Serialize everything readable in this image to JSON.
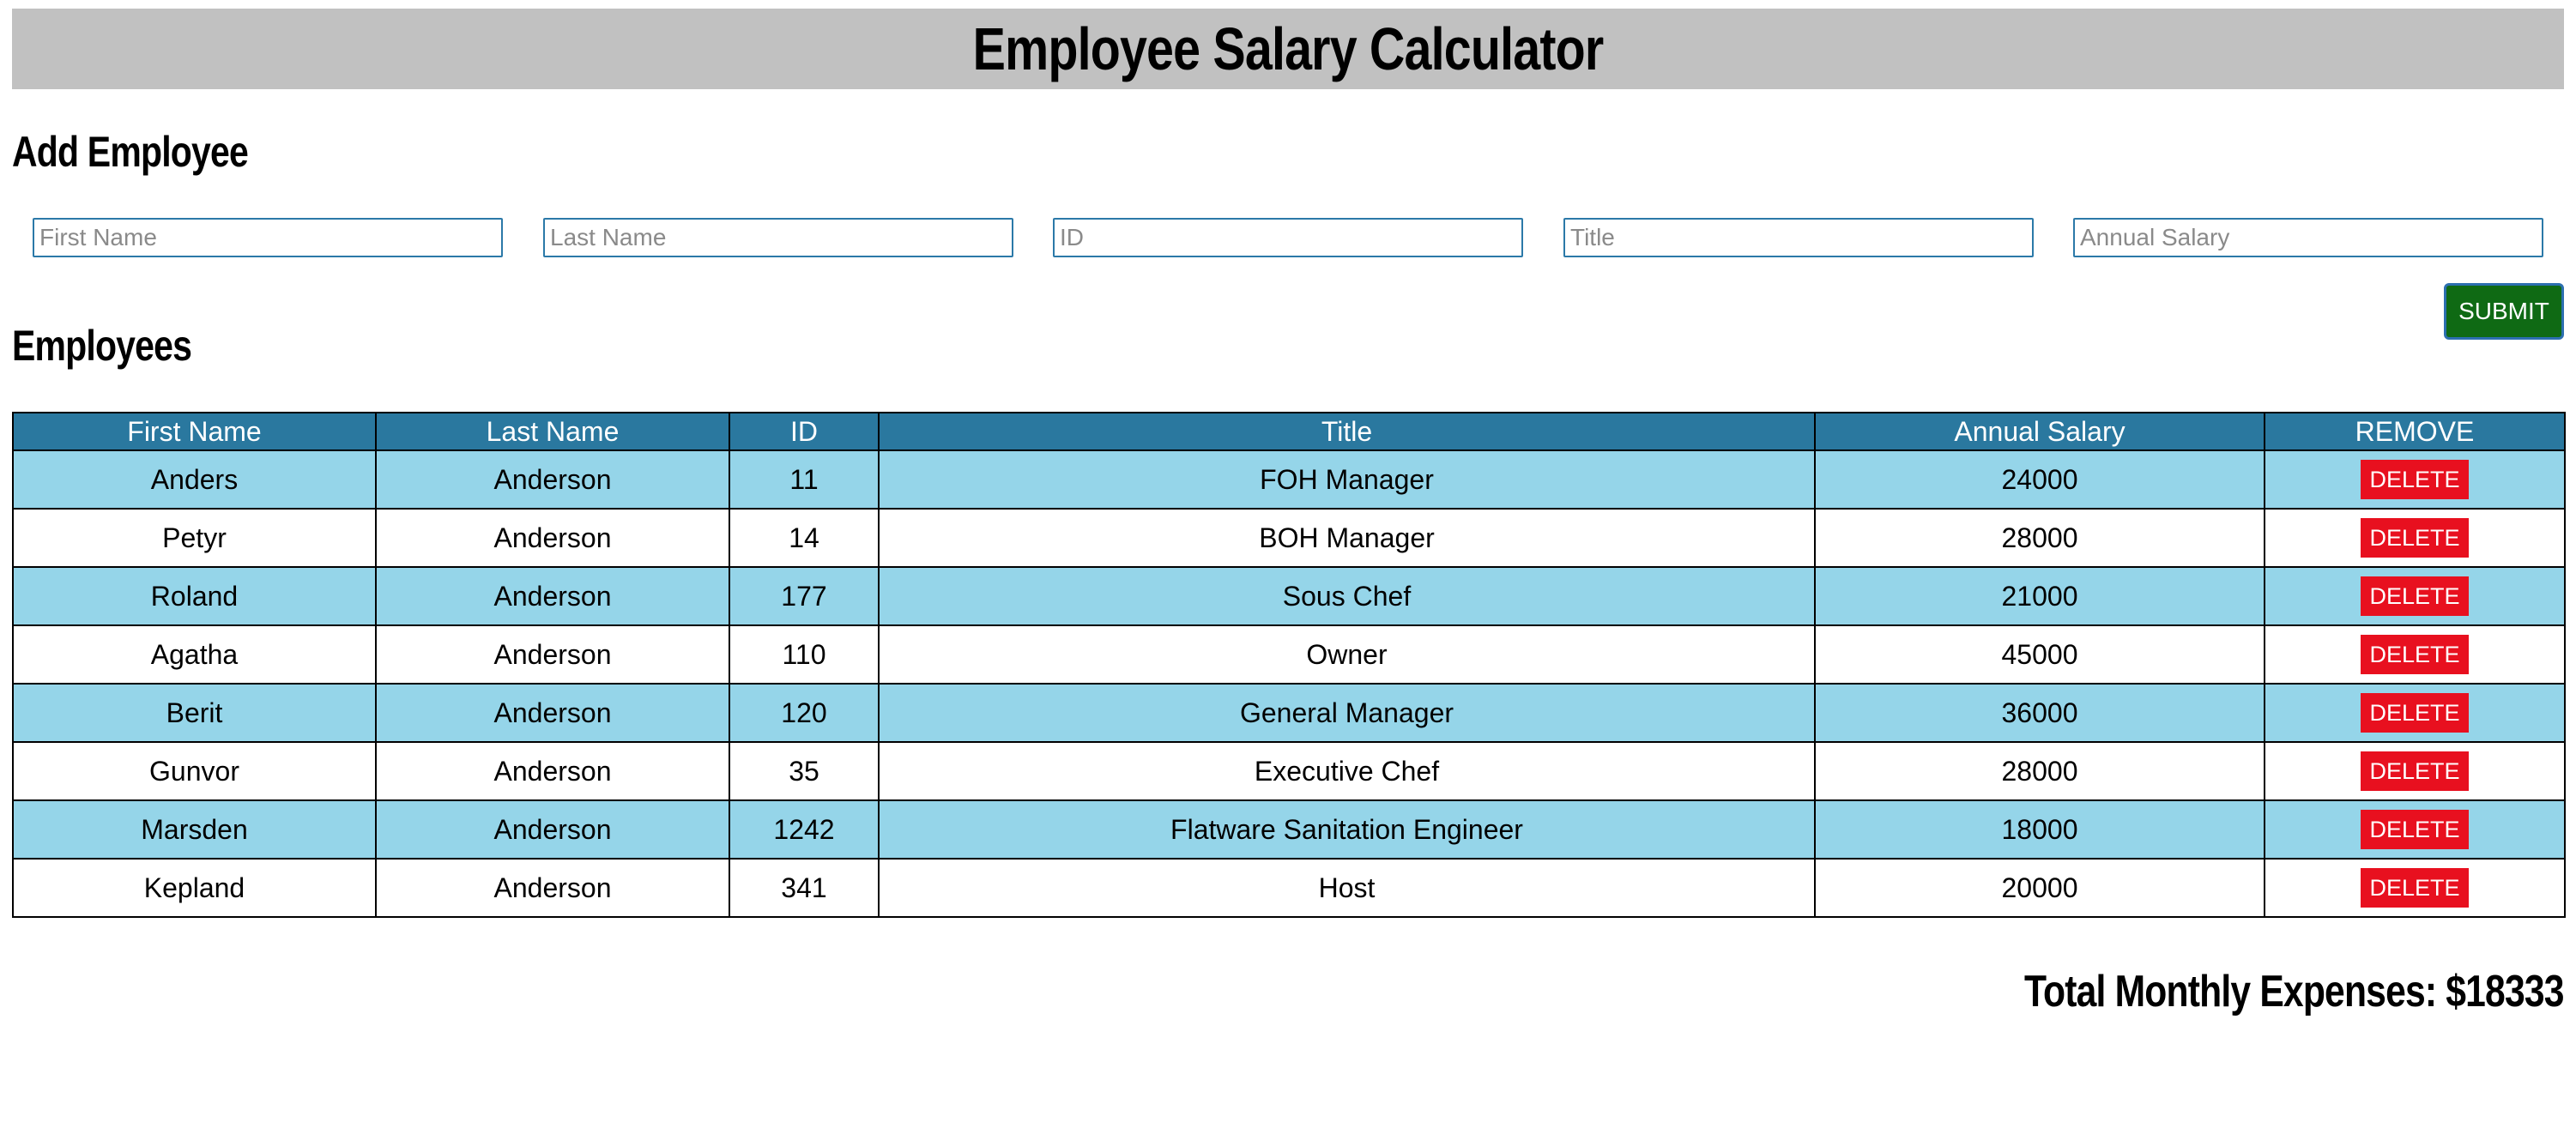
{
  "app": {
    "title": "Employee Salary Calculator"
  },
  "add_section": {
    "title": "Add Employee",
    "fields": [
      {
        "placeholder": "First Name",
        "value": ""
      },
      {
        "placeholder": "Last Name",
        "value": ""
      },
      {
        "placeholder": "ID",
        "value": ""
      },
      {
        "placeholder": "Title",
        "value": ""
      },
      {
        "placeholder": "Annual Salary",
        "value": ""
      }
    ],
    "submit_label": "SUBMIT"
  },
  "employees_section": {
    "title": "Employees",
    "columns": [
      "First Name",
      "Last Name",
      "ID",
      "Title",
      "Annual Salary",
      "REMOVE"
    ],
    "rows": [
      {
        "first": "Anders",
        "last": "Anderson",
        "id": "11",
        "title": "FOH Manager",
        "salary": "24000",
        "action": "DELETE"
      },
      {
        "first": "Petyr",
        "last": "Anderson",
        "id": "14",
        "title": "BOH Manager",
        "salary": "28000",
        "action": "DELETE"
      },
      {
        "first": "Roland",
        "last": "Anderson",
        "id": "177",
        "title": "Sous Chef",
        "salary": "21000",
        "action": "DELETE"
      },
      {
        "first": "Agatha",
        "last": "Anderson",
        "id": "110",
        "title": "Owner",
        "salary": "45000",
        "action": "DELETE"
      },
      {
        "first": "Berit",
        "last": "Anderson",
        "id": "120",
        "title": "General Manager",
        "salary": "36000",
        "action": "DELETE"
      },
      {
        "first": "Gunvor",
        "last": "Anderson",
        "id": "35",
        "title": "Executive Chef",
        "salary": "28000",
        "action": "DELETE"
      },
      {
        "first": "Marsden",
        "last": "Anderson",
        "id": "1242",
        "title": "Flatware Sanitation Engineer",
        "salary": "18000",
        "action": "DELETE"
      },
      {
        "first": "Kepland",
        "last": "Anderson",
        "id": "341",
        "title": "Host",
        "salary": "20000",
        "action": "DELETE"
      }
    ]
  },
  "footer": {
    "total_label": "Total Monthly Expenses: $18333"
  },
  "colors": {
    "header_bg": "#c1c1c1",
    "input_border": "#2b79a8",
    "submit_bg": "#0f6a14",
    "table_header_bg": "#2a789f",
    "row_alt_bg": "#95d5e9",
    "delete_bg": "#e8101f"
  }
}
